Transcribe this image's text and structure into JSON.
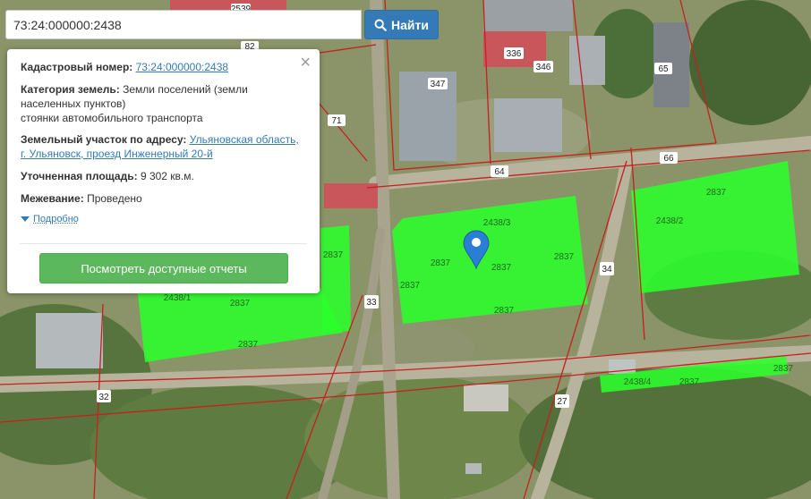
{
  "search": {
    "value": "73:24:000000:2438",
    "button_label": "Найти"
  },
  "popup": {
    "cadastral_label": "Кадастровый номер:",
    "cadastral_value": "73:24:000000:2438",
    "category_label": "Категория земель:",
    "category_value_1": "Земли поселений (земли",
    "category_value_2": "населенных пунктов)",
    "category_value_3": "стоянки автомобильного транспорта",
    "address_label": "Земельный участок по адресу:",
    "address_value_1": "Ульяновская область,",
    "address_value_2": "г. Ульяновск, проезд Инженерный 20-й",
    "area_label": "Уточненная площадь:",
    "area_value": "9 302 кв.м.",
    "survey_label": "Межевание:",
    "survey_value": "Проведено",
    "details_label": "Подробно",
    "reports_button": "Посмотреть доступные отчеты",
    "close_symbol": "×"
  },
  "map": {
    "labels": [
      "2539",
      "336",
      "346",
      "65",
      "347",
      "82",
      "71",
      "66",
      "64",
      "2438/2",
      "2837",
      "2837",
      "2438/3",
      "2837",
      "2837",
      "2837",
      "2837",
      "2438/1",
      "2837",
      "2837",
      "2837",
      "33",
      "34",
      "27",
      "32",
      "2438/4",
      "2837",
      "2837"
    ]
  },
  "colors": {
    "parcel_fill": "#2bff2b",
    "boundary": "#c81e1e",
    "search_button": "#337ab7",
    "reports_button": "#5cb85c",
    "marker": "#2a7fd4"
  }
}
